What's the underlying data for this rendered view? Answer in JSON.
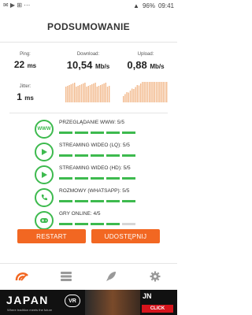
{
  "status_bar": {
    "battery": "96%",
    "time": "09:41"
  },
  "header": {
    "title": "PODSUMOWANIE"
  },
  "results": {
    "ping_label": "Ping:",
    "ping_value": "22",
    "ping_unit": "ms",
    "download_label": "Download:",
    "download_value": "10,54",
    "download_unit": "Mb/s",
    "upload_label": "Upload:",
    "upload_value": "0,88",
    "upload_unit": "Mb/s",
    "jitter_label": "Jitter:",
    "jitter_value": "1",
    "jitter_unit": "ms"
  },
  "quality": [
    {
      "label": "PRZEGLĄDANIE WWW: 5/5",
      "icon": "www-icon",
      "icon_text": "WWW",
      "score": 5,
      "max": 5
    },
    {
      "label": "STREAMING WIDEO (LQ): 5/5",
      "icon": "play-icon",
      "score": 5,
      "max": 5
    },
    {
      "label": "STREAMING WIDEO (HD): 5/5",
      "icon": "play-hd-icon",
      "score": 5,
      "max": 5
    },
    {
      "label": "ROZMOWY (WHATSAPP): 5/5",
      "icon": "phone-icon",
      "score": 5,
      "max": 5
    },
    {
      "label": "GRY ONLINE: 4/5",
      "icon": "gamepad-icon",
      "score": 4,
      "max": 5
    }
  ],
  "buttons": {
    "restart": "RESTART",
    "share": "UDOSTĘPNIJ"
  },
  "nav": [
    "speedometer-icon",
    "list-icon",
    "rocket-icon",
    "gear-icon"
  ],
  "ad": {
    "title": "JAPAN",
    "badge": "VR",
    "tagline": "Where tradition meets the future",
    "brand": "JN",
    "cta": "CLICK"
  },
  "colors": {
    "accent": "#f26722",
    "green": "#3dba4e",
    "graph": "#f2b98c"
  }
}
